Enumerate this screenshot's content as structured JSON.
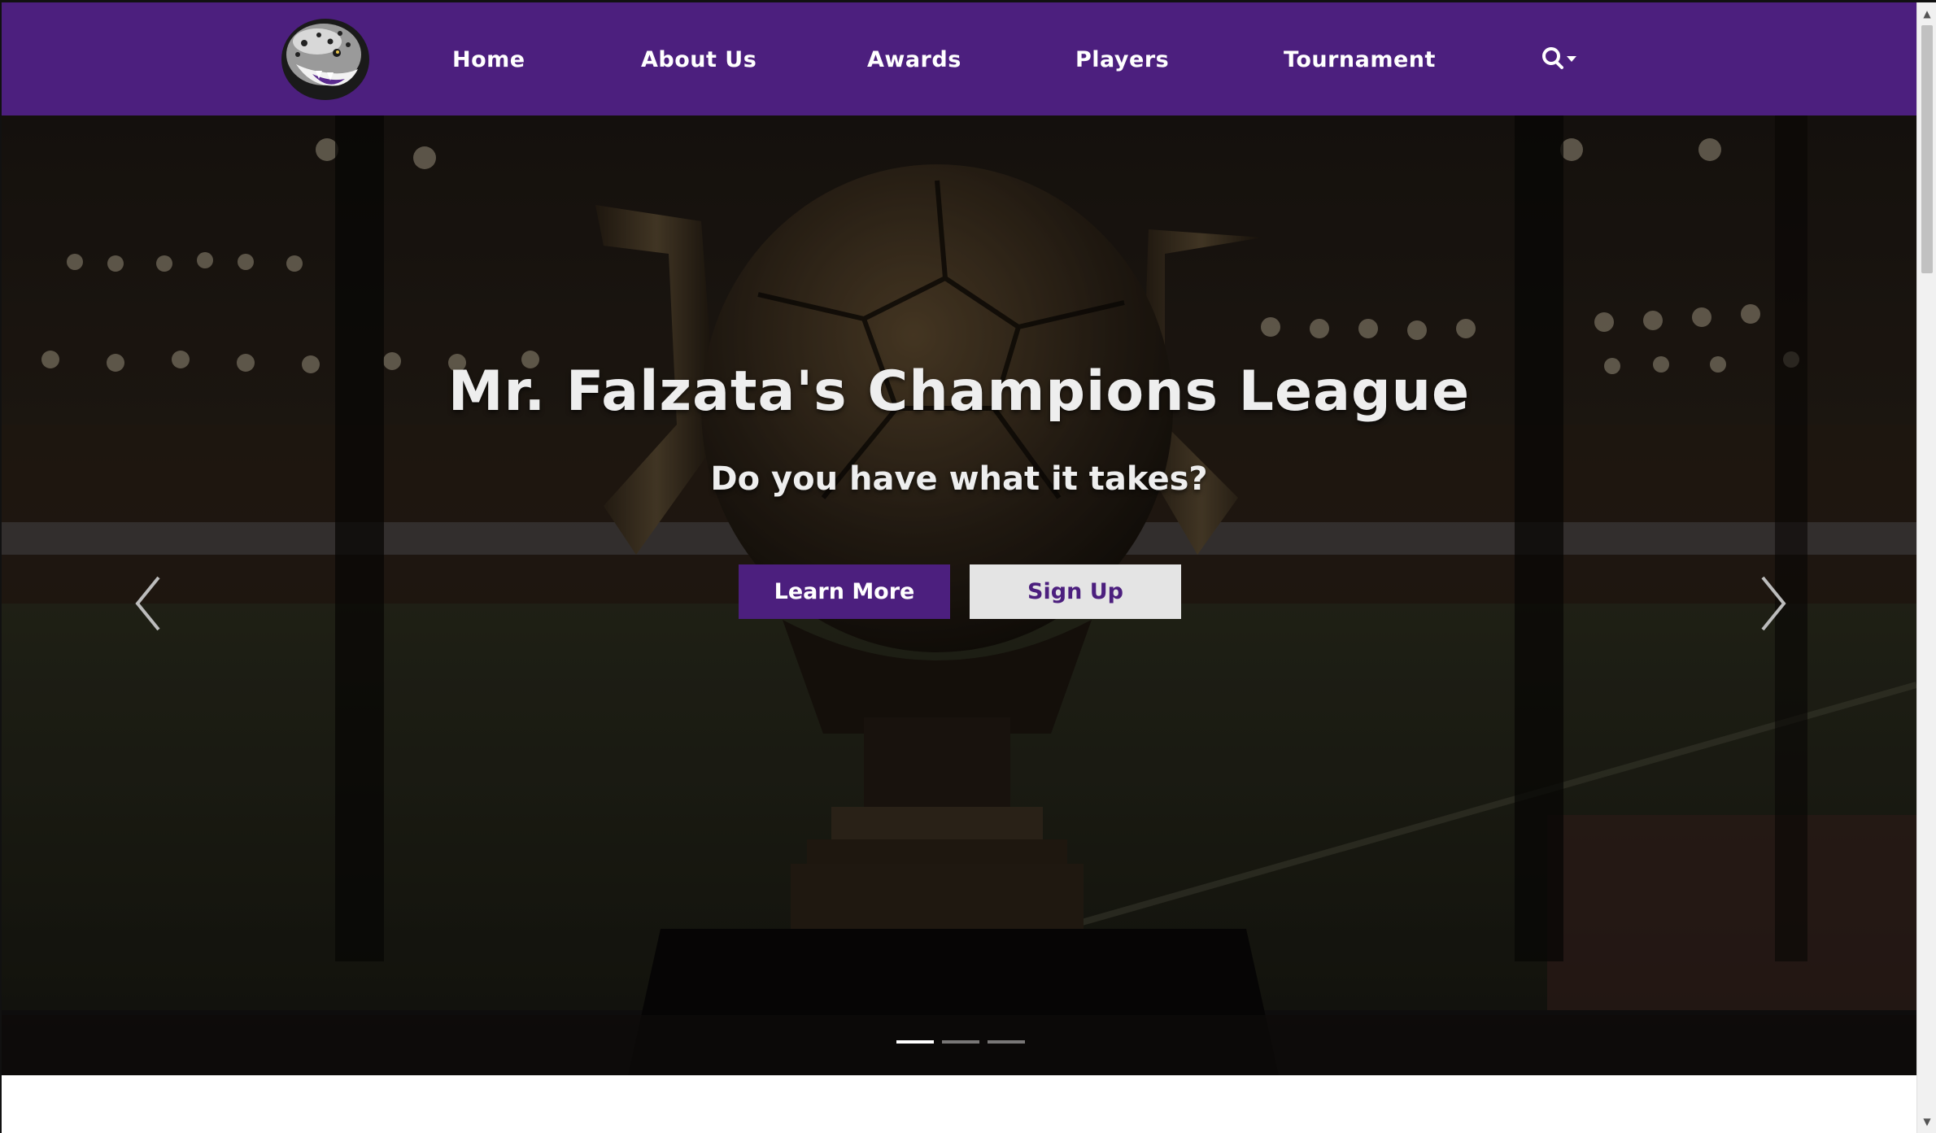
{
  "navbar": {
    "logo_alt": "jaguar-logo",
    "items": [
      {
        "label": "Home"
      },
      {
        "label": "About Us"
      },
      {
        "label": "Awards"
      },
      {
        "label": "Players"
      },
      {
        "label": "Tournament"
      }
    ],
    "search_icon": "search-icon",
    "brand_color": "#4c1f7e"
  },
  "hero": {
    "title": "Mr. Falzata's Champions League",
    "subtitle": "Do you have what it takes?",
    "primary_button": "Learn More",
    "secondary_button": "Sign Up",
    "slides_total": 3,
    "active_slide": 1,
    "prev_icon": "chevron-left-icon",
    "next_icon": "chevron-right-icon"
  },
  "colors": {
    "accent": "#4c1f7e",
    "button_light": "#e4e4e4",
    "text_light": "#eeeeee"
  }
}
